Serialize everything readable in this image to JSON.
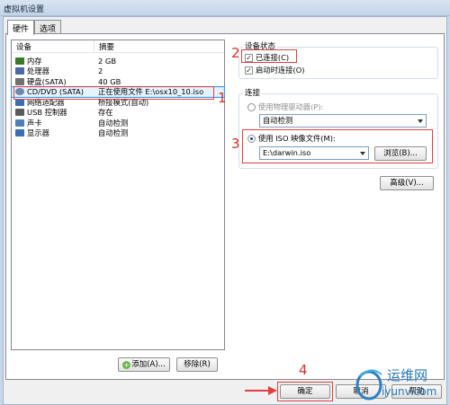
{
  "window": {
    "title": "虚拟机设置"
  },
  "tabs": [
    {
      "label": "硬件"
    },
    {
      "label": "选项"
    }
  ],
  "device_list": {
    "headers": [
      "设备",
      "摘要"
    ],
    "rows": [
      {
        "device": "内存",
        "summary": "2 GB",
        "icon": "memory-icon",
        "color": "#3a7a2a"
      },
      {
        "device": "处理器",
        "summary": "2",
        "icon": "processor-icon",
        "color": "#4a6aa5"
      },
      {
        "device": "硬盘(SATA)",
        "summary": "40 GB",
        "icon": "hard-disk-icon",
        "color": "#707070"
      },
      {
        "device": "CD/DVD (SATA)",
        "summary": "正在使用文件 E:\\osx10_10.iso",
        "icon": "cd-dvd-icon",
        "color": "#6a8ab0",
        "selected": true
      },
      {
        "device": "网络适配器",
        "summary": "桥接模式(自动)",
        "icon": "network-adapter-icon",
        "color": "#3b6fb0"
      },
      {
        "device": "USB 控制器",
        "summary": "存在",
        "icon": "usb-icon",
        "color": "#5a5a5a"
      },
      {
        "device": "声卡",
        "summary": "自动检测",
        "icon": "speaker-icon",
        "color": "#4f7fb8"
      },
      {
        "device": "显示器",
        "summary": "自动检测",
        "icon": "monitor-icon",
        "color": "#3a6db5"
      }
    ],
    "add_button": "添加(A)...",
    "remove_button": "移除(R)"
  },
  "device_status": {
    "title": "设备状态",
    "connected": {
      "label": "已连接(C)",
      "checked": true
    },
    "connect_at_power_on": {
      "label": "启动时连接(O)",
      "checked": true
    }
  },
  "connection": {
    "title": "连接",
    "physical_drive": {
      "label": "使用物理驱动器(P):",
      "selected": false,
      "value": "自动检测"
    },
    "iso_image": {
      "label": "使用 ISO 映像文件(M):",
      "selected": true,
      "value": "E:\\darwin.iso",
      "browse_button": "浏览(B)..."
    },
    "advanced_button": "高级(V)..."
  },
  "footer": {
    "ok_button": "确定",
    "cancel_button": "取消",
    "help_button": "帮助"
  },
  "annotations": [
    "1",
    "2",
    "3",
    "4"
  ],
  "watermark": {
    "text": "运维网",
    "url_text": "iyunv.com"
  }
}
